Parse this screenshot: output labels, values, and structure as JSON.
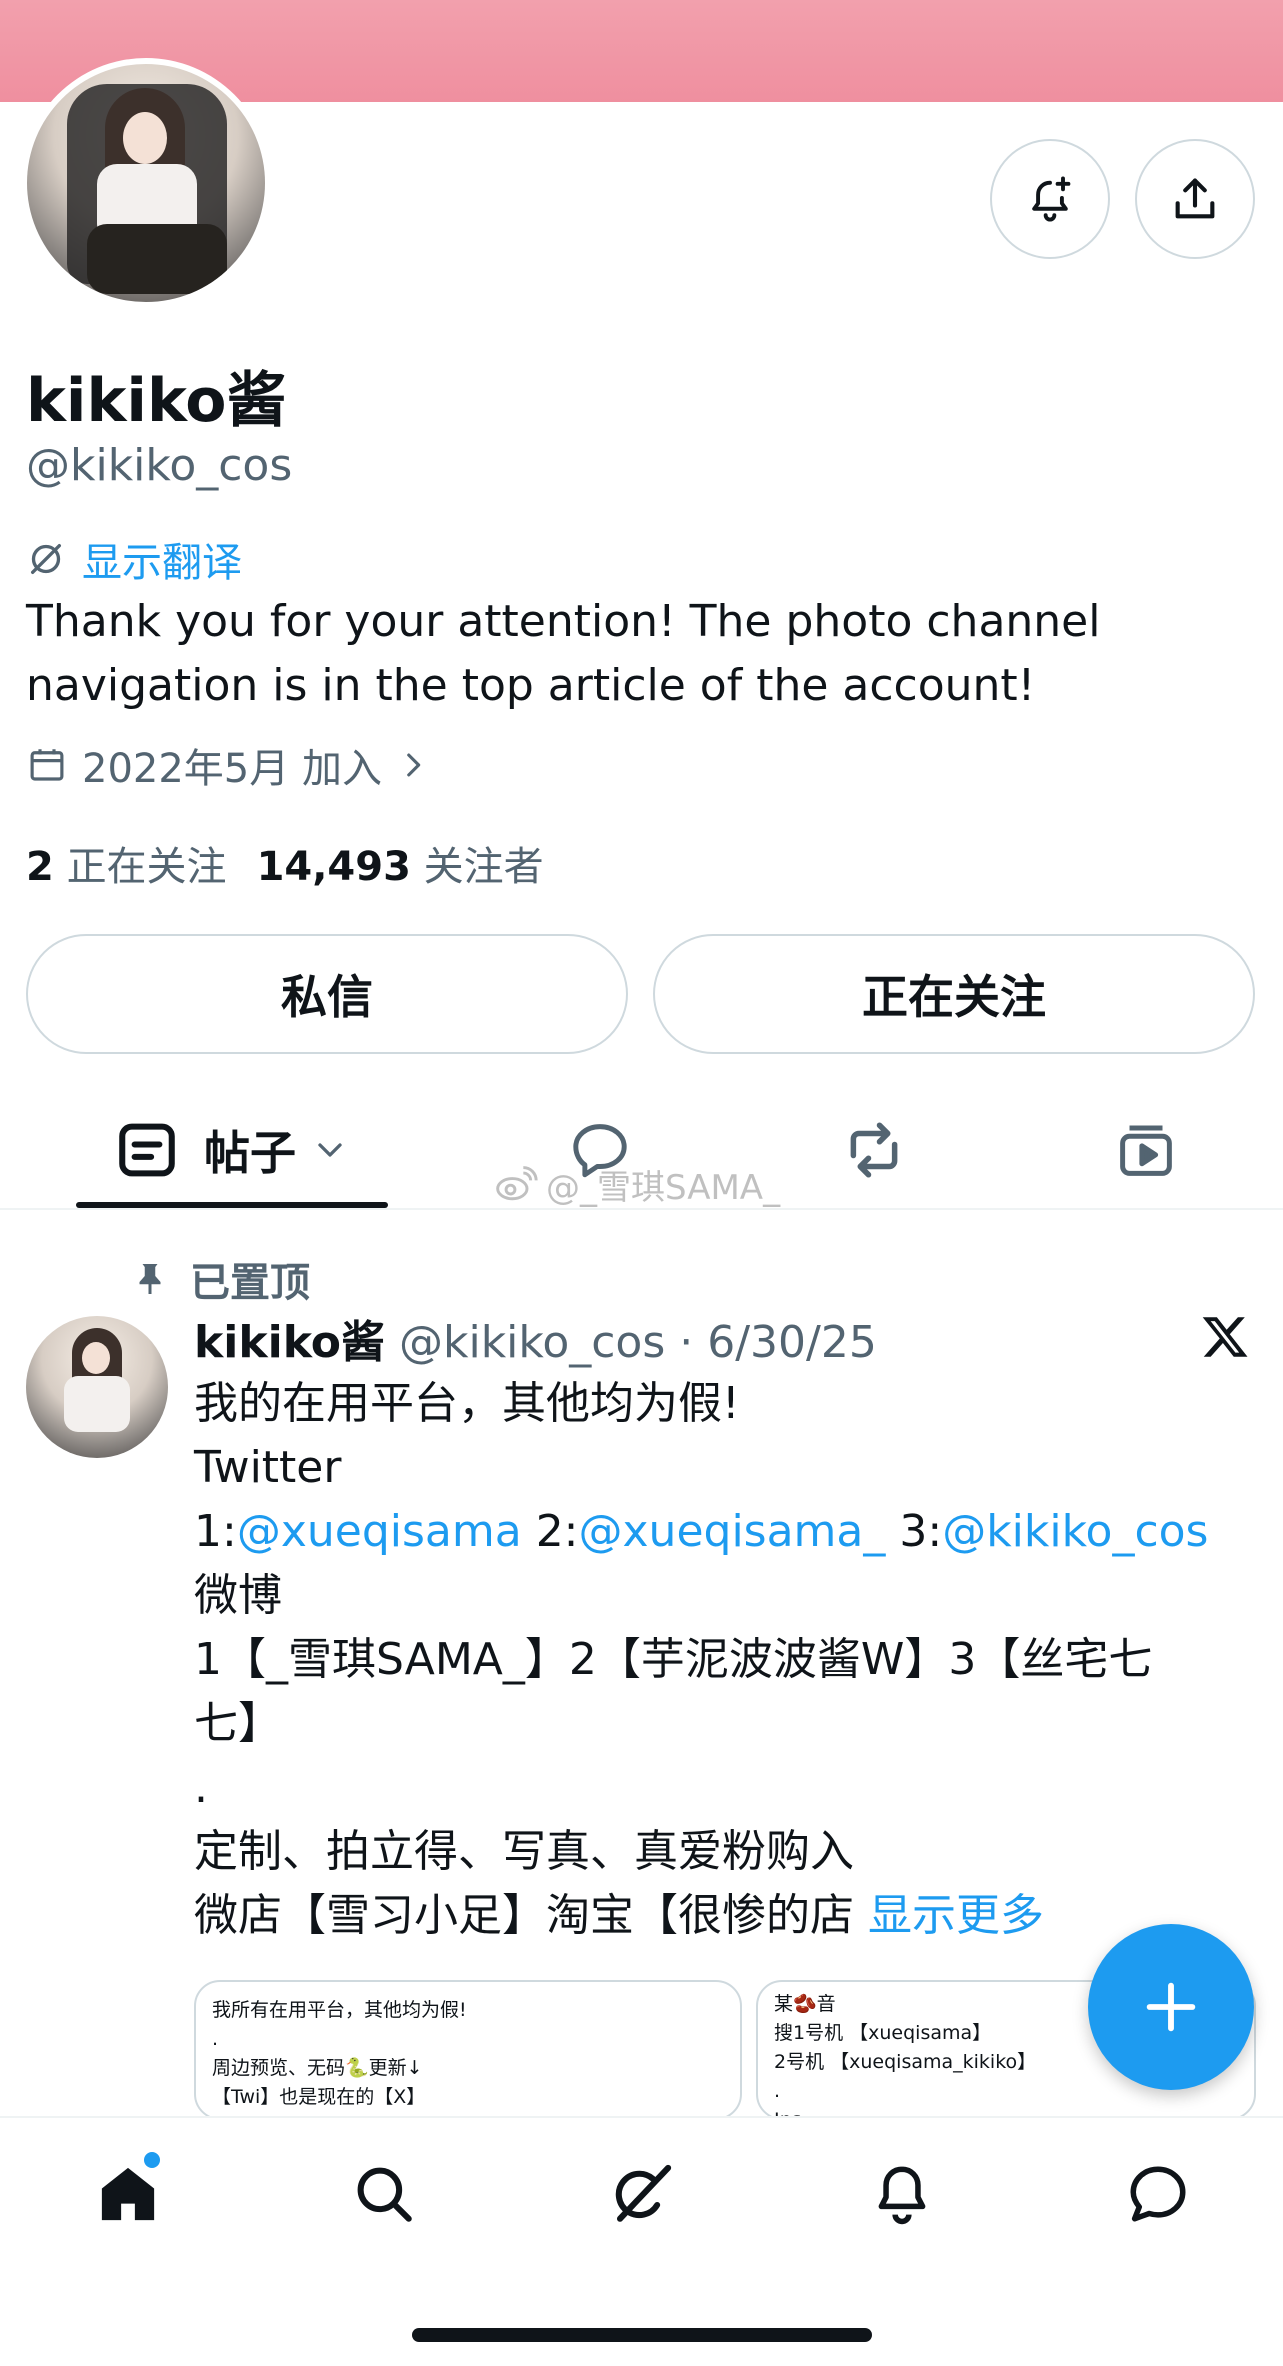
{
  "profile": {
    "display_name": "kikiko酱",
    "handle": "@kikiko_cos",
    "translate_label": "显示翻译",
    "bio_line1": "Thank you for your attention! The photo channel",
    "bio_line2": "navigation is in the top article of the account!",
    "joined": "2022年5月 加入",
    "following_count": "2",
    "following_label": "正在关注",
    "followers_count": "14,493",
    "followers_label": "关注者"
  },
  "actions": {
    "message_label": "私信",
    "following_button_label": "正在关注"
  },
  "tabs": {
    "posts_label": "帖子"
  },
  "watermark": "@_雪琪SAMA_",
  "pinned_post": {
    "pinned_label": "已置顶",
    "author_name": "kikiko酱",
    "meta": "@kikiko_cos · 6/30/25",
    "lines": {
      "l1": "我的在用平台，其他均为假!",
      "l2": "Twitter",
      "l3_a": "1:",
      "l3_b": "@xueqisama",
      "l3_c": " 2:",
      "l3_d": "@xueqisama_",
      "l3_e": " 3:",
      "l3_f": "@kikiko_cos",
      "l4": "微博",
      "l5": "1【_雪琪SAMA_】2【芋泥波波酱W】3【丝宅七",
      "l6": "七】",
      "l7": ".",
      "l8": "定制、拍立得、写真、真爱粉购入",
      "l9": "微店【雪习小足】淘宝【很惨的店",
      "show_more": "显示更多"
    },
    "card1": {
      "line1": "我所有在用平台，其他均为假!",
      "line2": ".",
      "line3": "周边预览、无码🐍更新↓",
      "line4": "【Twi】也是现在的【X】"
    },
    "card2": {
      "line1": "某🫘音",
      "line2": "搜1号机 【xueqisama】",
      "line3": "  2号机 【xueqisama_kikiko】",
      "line4": ".",
      "line5": "Ins"
    }
  },
  "colors": {
    "accent": "#1d9bf0",
    "banner": "#ef8f9f",
    "text_primary": "#0f1419",
    "text_secondary": "#536471"
  },
  "icons": {
    "notify": "bell-plus-icon",
    "share": "share-icon",
    "translate": "translate-icon",
    "calendar": "calendar-icon",
    "pin": "pin-icon",
    "x_logo": "x-logo-icon",
    "compose": "plus-icon",
    "home": "home-icon",
    "search": "search-icon",
    "grok": "grok-icon",
    "notifications": "bell-icon",
    "messages": "chat-icon"
  }
}
